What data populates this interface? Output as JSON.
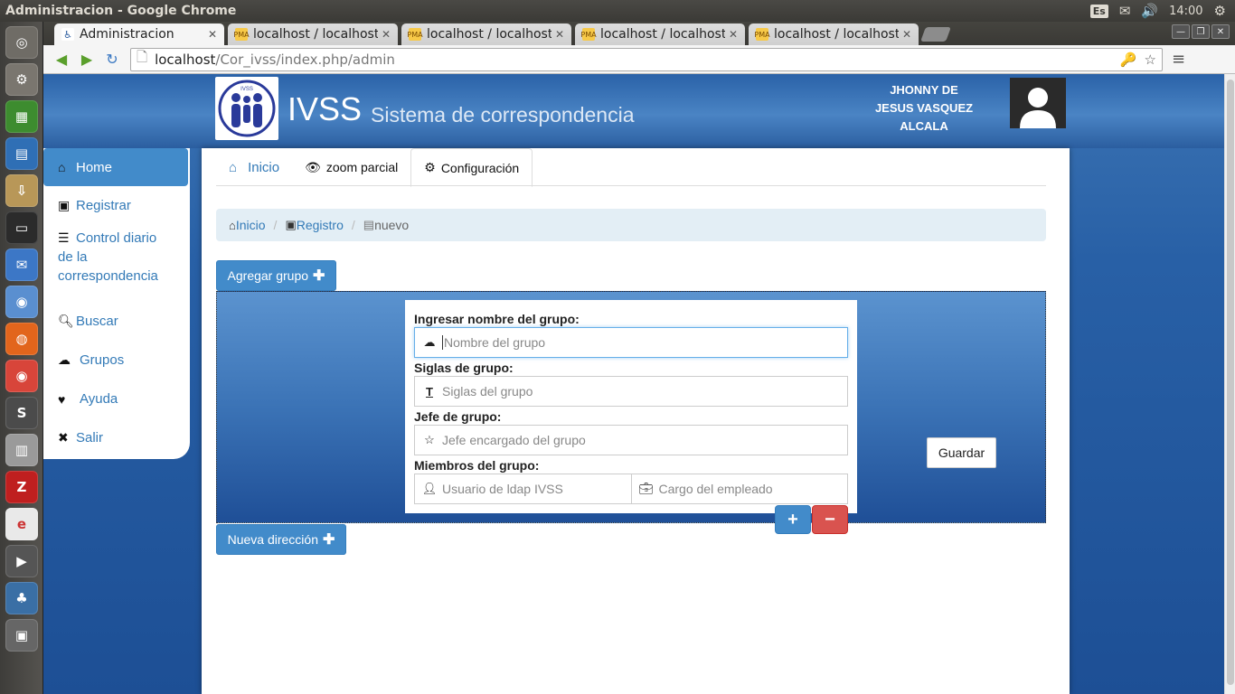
{
  "os_panel": {
    "window_title": "Administracion - Google Chrome",
    "keyboard_layout": "Es",
    "clock": "14:00"
  },
  "launcher": {
    "items": [
      {
        "icon": "ubuntu-dash-icon",
        "color": "#6f6c66"
      },
      {
        "icon": "settings-gear-icon",
        "color": "#7a766f"
      },
      {
        "icon": "spreadsheet-icon",
        "color": "#3d8c2f"
      },
      {
        "icon": "document-writer-icon",
        "color": "#2f6fb5"
      },
      {
        "icon": "archive-manager-icon",
        "color": "#b89758"
      },
      {
        "icon": "terminal-icon",
        "color": "#2b2b2b"
      },
      {
        "icon": "thunderbird-icon",
        "color": "#3c77c6"
      },
      {
        "icon": "chromium-icon",
        "color": "#5a8fd0"
      },
      {
        "icon": "firefox-icon",
        "color": "#e2651c"
      },
      {
        "icon": "chrome-icon",
        "color": "#d8453a"
      },
      {
        "icon": "sublime-text-icon",
        "color": "#4b4b4b"
      },
      {
        "icon": "file-cabinet-icon",
        "color": "#9a9a9a"
      },
      {
        "icon": "filezilla-icon",
        "color": "#bf1f1f"
      },
      {
        "icon": "eclipse-icon",
        "color": "#e9e9e9"
      },
      {
        "icon": "video-editor-icon",
        "color": "#555555"
      },
      {
        "icon": "python-icon",
        "color": "#3a6fa5"
      },
      {
        "icon": "system-monitor-icon",
        "color": "#666666"
      }
    ]
  },
  "browser": {
    "tabs": [
      {
        "label": "Administracion",
        "active": true
      },
      {
        "label": "localhost / localhost",
        "active": false
      },
      {
        "label": "localhost / localhost",
        "active": false
      },
      {
        "label": "localhost / localhost",
        "active": false
      },
      {
        "label": "localhost / localhost",
        "active": false
      }
    ],
    "url_host": "localhost",
    "url_path": "/Cor_ivss/index.php/admin"
  },
  "app": {
    "logo_text": "IVSS",
    "brand": "IVSS",
    "subtitle": "Sistema de correspondencia",
    "user_name_lines": [
      "JHONNY DE",
      "JESUS VASQUEZ",
      "ALCALA"
    ]
  },
  "sidebar": {
    "items": [
      {
        "label": "Home",
        "icon": "home-icon"
      },
      {
        "label": "Registrar",
        "icon": "floppy-disk-icon"
      },
      {
        "label": "Control diario de la correspondencia",
        "icon": "list-icon"
      },
      {
        "label": "Buscar",
        "icon": "search-icon"
      },
      {
        "label": "Grupos",
        "icon": "cloud-icon"
      },
      {
        "label": "Ayuda",
        "icon": "heart-icon"
      },
      {
        "label": "Salir",
        "icon": "close-icon"
      }
    ]
  },
  "content_tabs": {
    "inicio": "Inicio",
    "zoom": "zoom parcial",
    "config": "Configuración"
  },
  "breadcrumb": {
    "inicio": "Inicio",
    "registro": "Registro",
    "nuevo": "nuevo"
  },
  "form": {
    "add_group_label": "Agregar grupo",
    "name_label": "Ingresar nombre del grupo:",
    "name_placeholder": "Nombre del grupo",
    "siglas_label": "Siglas de grupo:",
    "siglas_placeholder": "Siglas del grupo",
    "jefe_label": "Jefe de grupo:",
    "jefe_placeholder": "Jefe encargado del grupo",
    "miembros_label": "Miembros del grupo:",
    "usuario_placeholder": "Usuario de ldap IVSS",
    "cargo_placeholder": "Cargo del empleado",
    "save_label": "Guardar",
    "plus_symbol": "+",
    "minus_symbol": "−",
    "new_direction_label": "Nueva dirección"
  },
  "colors": {
    "primary": "#428bca",
    "danger": "#d9534f",
    "link": "#337ab7"
  }
}
